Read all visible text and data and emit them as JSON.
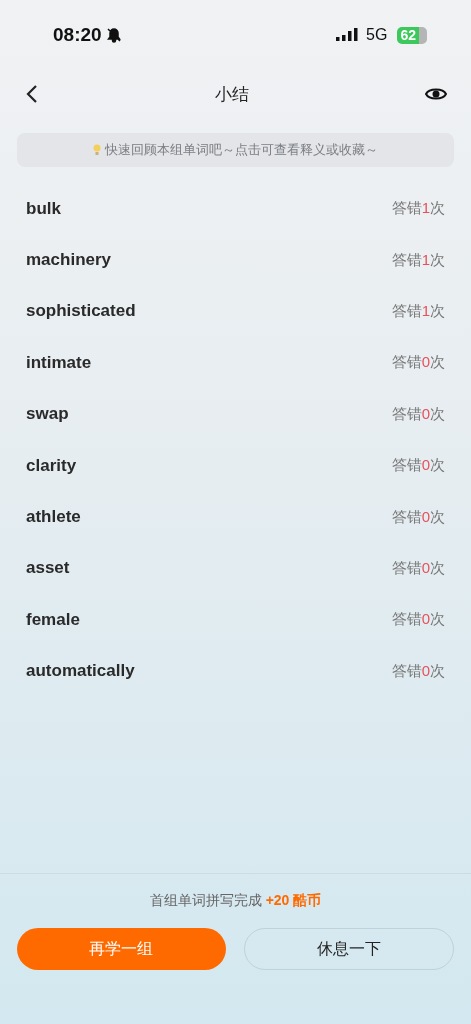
{
  "status_bar": {
    "time": "08:20",
    "network": "5G",
    "battery": "62"
  },
  "header": {
    "title": "小结"
  },
  "tip": {
    "text": "快速回顾本组单词吧～点击可查看释义或收藏～"
  },
  "words": [
    {
      "word": "bulk",
      "prefix": "答错",
      "count": "1",
      "suffix": "次"
    },
    {
      "word": "machinery",
      "prefix": "答错",
      "count": "1",
      "suffix": "次"
    },
    {
      "word": "sophisticated",
      "prefix": "答错",
      "count": "1",
      "suffix": "次"
    },
    {
      "word": "intimate",
      "prefix": "答错",
      "count": "0",
      "suffix": "次"
    },
    {
      "word": "swap",
      "prefix": "答错",
      "count": "0",
      "suffix": "次"
    },
    {
      "word": "clarity",
      "prefix": "答错",
      "count": "0",
      "suffix": "次"
    },
    {
      "word": "athlete",
      "prefix": "答错",
      "count": "0",
      "suffix": "次"
    },
    {
      "word": "asset",
      "prefix": "答错",
      "count": "0",
      "suffix": "次"
    },
    {
      "word": "female",
      "prefix": "答错",
      "count": "0",
      "suffix": "次"
    },
    {
      "word": "automatically",
      "prefix": "答错",
      "count": "0",
      "suffix": "次"
    }
  ],
  "footer": {
    "message": "首组单词拼写完成",
    "reward": "+20 酷币",
    "buttons": [
      {
        "label": "再学一组",
        "kind": "primary"
      },
      {
        "label": "休息一下",
        "kind": "secondary"
      }
    ]
  }
}
